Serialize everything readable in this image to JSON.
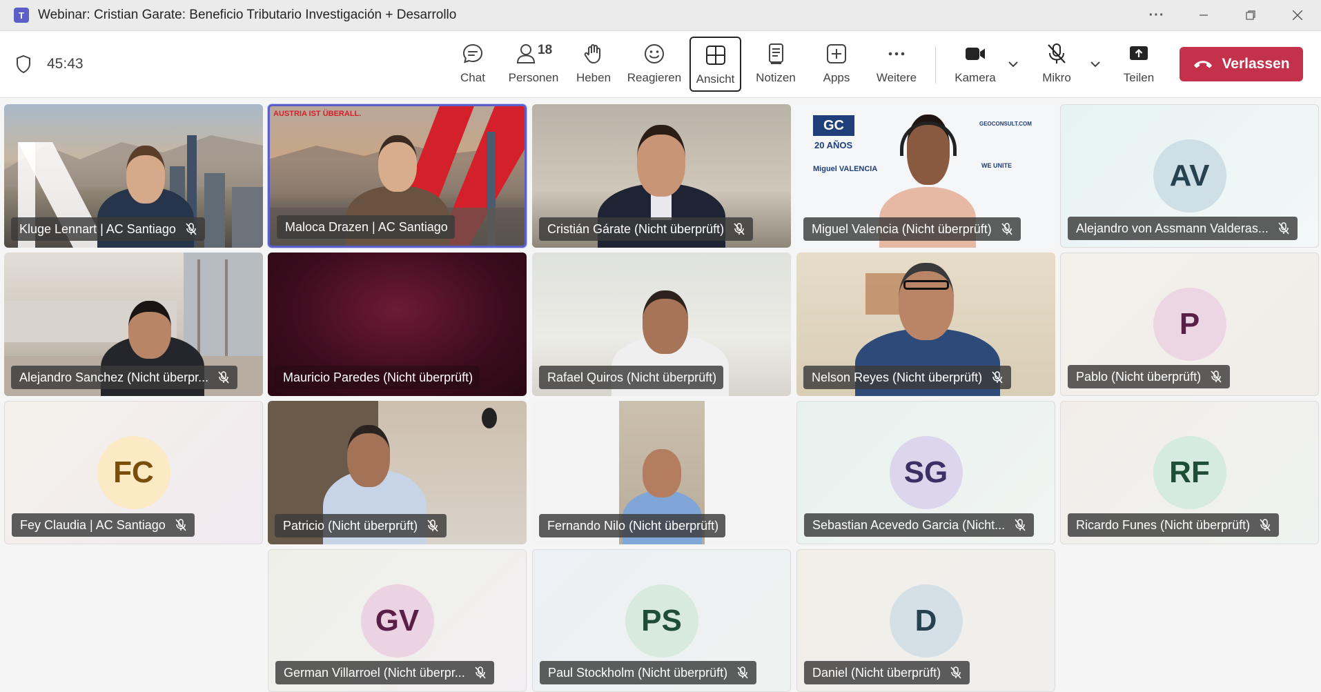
{
  "window": {
    "title": "Webinar: Cristian Garate: Beneficio Tributario Investigación + Desarrollo",
    "app_logo": "T",
    "more_label": "···"
  },
  "toolbar": {
    "timer": "45:43",
    "chat_label": "Chat",
    "people_label": "Personen",
    "people_count": "18",
    "raise_label": "Heben",
    "react_label": "Reagieren",
    "view_label": "Ansicht",
    "notes_label": "Notizen",
    "apps_label": "Apps",
    "more_label": "Weitere",
    "camera_label": "Kamera",
    "mic_label": "Mikro",
    "share_label": "Teilen",
    "leave_label": "Verlassen"
  },
  "colors": {
    "accent": "#5b5fc7",
    "leave": "#c4314b",
    "badge": "#3a3a3a"
  },
  "tiles": [
    {
      "name": "Kluge Lennart | AC Santiago",
      "muted": true
    },
    {
      "name": "Maloca Drazen | AC Santiago",
      "muted": false,
      "overlay": "AUSTRIA IST ÜBERALL."
    },
    {
      "name": "Cristián Gárate (Nicht überprüft)",
      "muted": true
    },
    {
      "name": "Miguel Valencia (Nicht überprüft)",
      "muted": true,
      "logo": "GC",
      "years": "20 AÑOS",
      "caption": "Miguel VALENCIA",
      "slogan": "WE UNITE",
      "website": "GEOCONSULT.COM"
    },
    {
      "name": "Alejandro von Assmann Valderas...",
      "muted": true,
      "initials": "AV"
    },
    {
      "name": "Alejandro Sanchez (Nicht überpr...",
      "muted": true
    },
    {
      "name": "Mauricio Paredes (Nicht überprüft)",
      "muted": false
    },
    {
      "name": "Rafael Quiros (Nicht überprüft)",
      "muted": false
    },
    {
      "name": "Nelson Reyes (Nicht überprüft)",
      "muted": true
    },
    {
      "name": "Pablo (Nicht überprüft)",
      "muted": true,
      "initials": "P"
    },
    {
      "name": "Fey Claudia | AC Santiago",
      "muted": true,
      "initials": "FC"
    },
    {
      "name": "Patricio (Nicht überprüft)",
      "muted": true
    },
    {
      "name": "Fernando Nilo (Nicht überprüft)",
      "muted": false
    },
    {
      "name": "Sebastian Acevedo Garcia (Nicht...",
      "muted": true,
      "initials": "SG"
    },
    {
      "name": "Ricardo Funes (Nicht überprüft)",
      "muted": true,
      "initials": "RF"
    },
    {
      "name": "German Villarroel (Nicht überpr...",
      "muted": true,
      "initials": "GV"
    },
    {
      "name": "Paul Stockholm (Nicht überprüft)",
      "muted": true,
      "initials": "PS"
    },
    {
      "name": "Daniel (Nicht überprüft)",
      "muted": true,
      "initials": "D"
    }
  ]
}
